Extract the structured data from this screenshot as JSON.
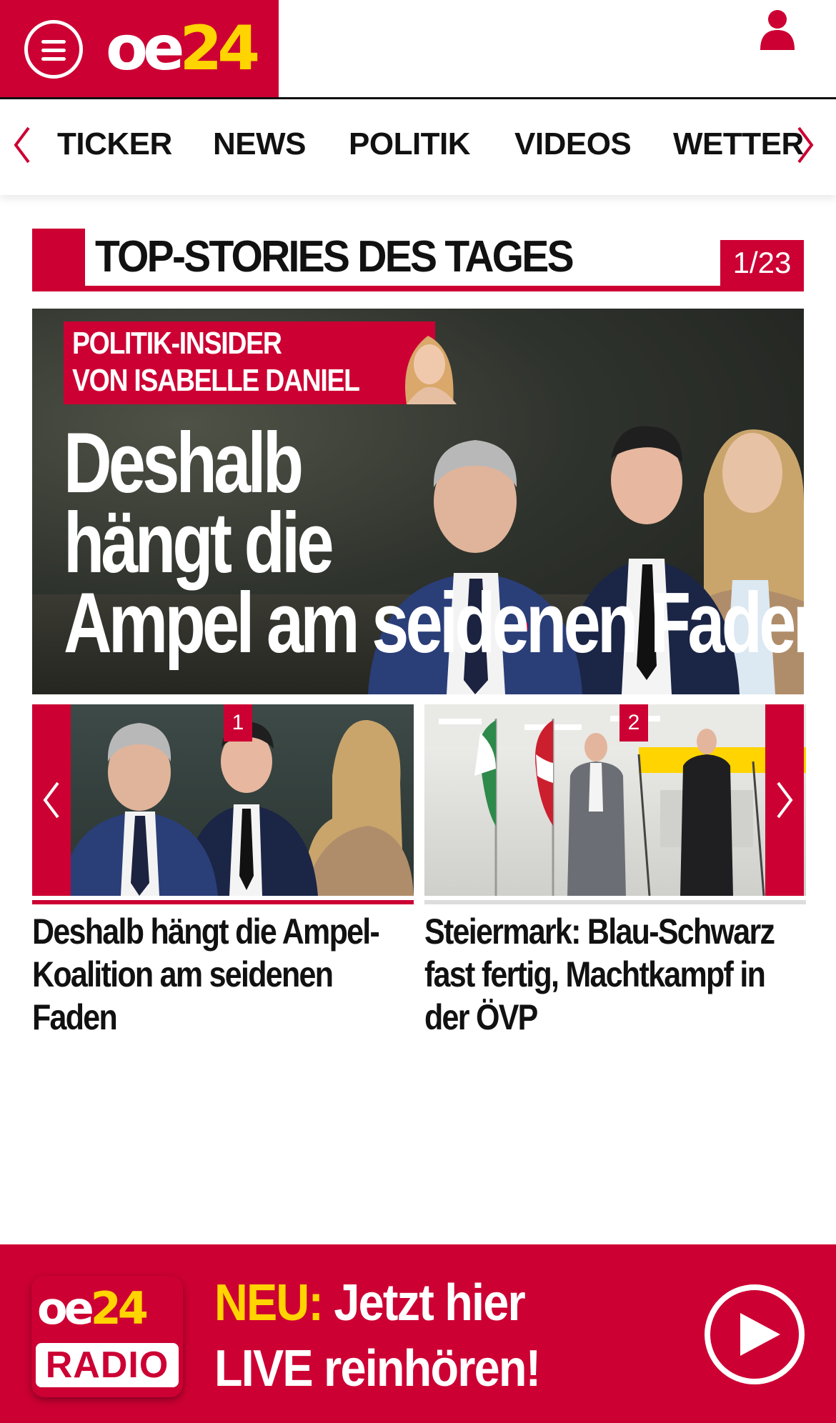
{
  "header": {
    "logo_prefix": "oe",
    "logo_number": "24",
    "brand_color": "#cc0033",
    "accent_color": "#ffd400",
    "icons": [
      "menu-icon",
      "user-icon"
    ]
  },
  "nav": {
    "items": [
      {
        "label": "TICKER"
      },
      {
        "label": "NEWS"
      },
      {
        "label": "POLITIK"
      },
      {
        "label": "VIDEOS"
      },
      {
        "label": "WETTER"
      }
    ]
  },
  "section": {
    "title": "TOP-STORIES DES TAGES",
    "counter": "1/23"
  },
  "hero": {
    "badge_line1": "POLITIK-INSIDER",
    "badge_line2": "VON ISABELLE DANIEL",
    "headline_line1": "Deshalb",
    "headline_line2": "hängt die",
    "headline_line3": "Ampel am seidenen Faden"
  },
  "carousel": {
    "cards": [
      {
        "number": "1",
        "headline": "Deshalb hängt die Ampel-Koalition am seidenen Faden"
      },
      {
        "number": "2",
        "headline": "Steiermark: Blau-Schwarz fast fertig, Machtkampf in der ÖVP"
      }
    ]
  },
  "radio": {
    "logo_prefix": "oe",
    "logo_number": "24",
    "logo_label": "RADIO",
    "neu": "NEU:",
    "line1": "Jetzt hier",
    "line2": "LIVE reinhören!"
  }
}
